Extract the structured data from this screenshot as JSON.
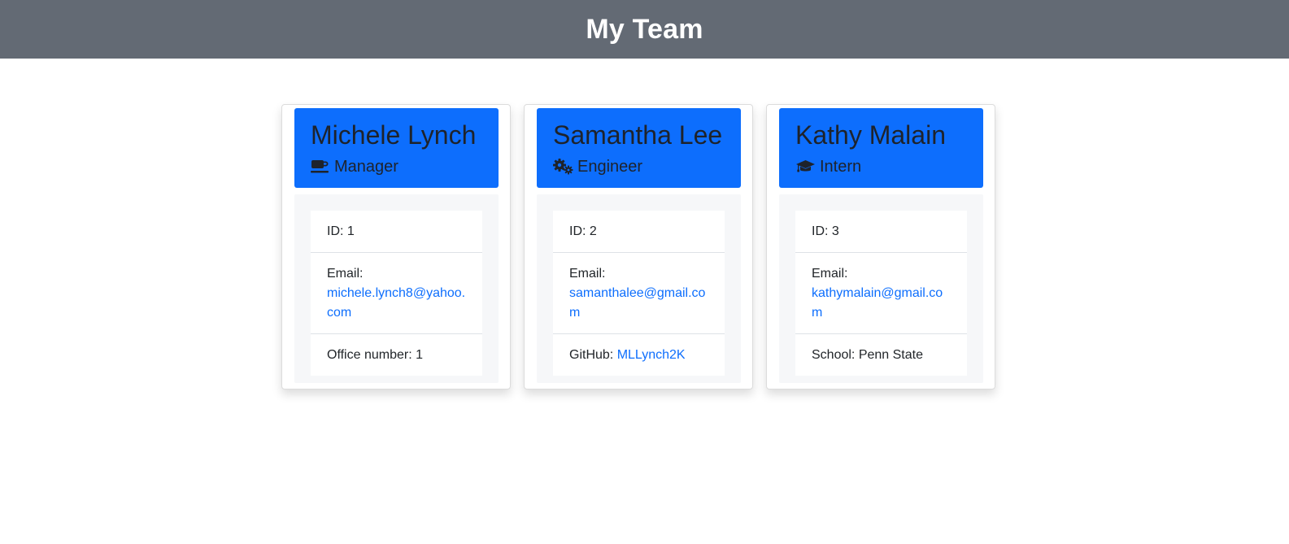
{
  "page": {
    "title": "My Team"
  },
  "team": [
    {
      "name": "Michele Lynch",
      "role": "Manager",
      "role_icon": "coffee-icon",
      "id_text": "ID: 1",
      "email_label": "Email:",
      "email": "michele.lynch8@yahoo.com",
      "extra_label": "Office number: 1",
      "extra_link": ""
    },
    {
      "name": "Samantha Lee",
      "role": "Engineer",
      "role_icon": "gears-icon",
      "id_text": "ID: 2",
      "email_label": "Email:",
      "email": "samanthalee@gmail.com",
      "extra_label": "GitHub: ",
      "extra_link": "MLLynch2K"
    },
    {
      "name": "Kathy Malain",
      "role": "Intern",
      "role_icon": "graduation-cap-icon",
      "id_text": "ID: 3",
      "email_label": "Email:",
      "email": "kathymalain@gmail.com",
      "extra_label": "School: Penn State",
      "extra_link": ""
    }
  ],
  "colors": {
    "header_bar": "#636a74",
    "card_header": "#0d6efd",
    "link": "#0d6efd"
  }
}
